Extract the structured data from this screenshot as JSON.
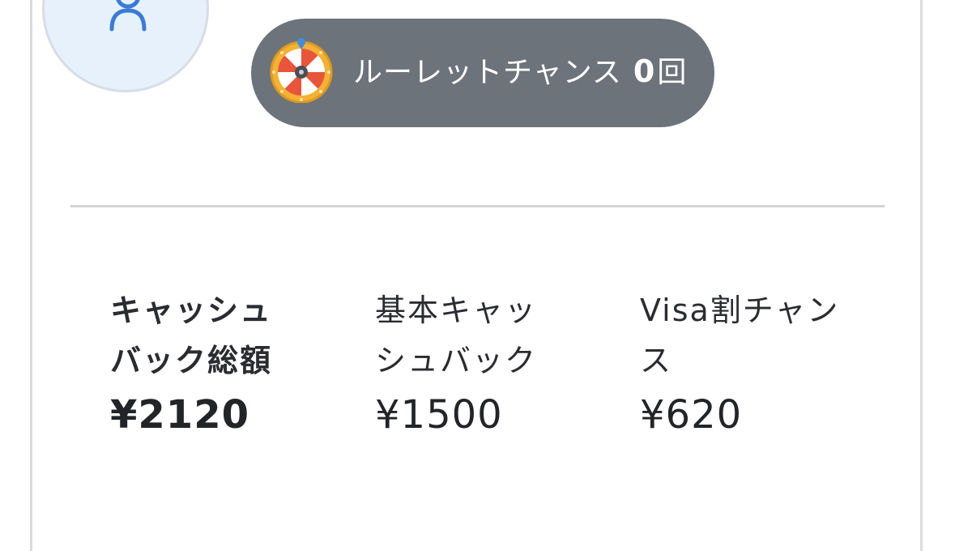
{
  "avatar": {
    "icon": "user-icon",
    "bg_color": "#e7f1fc",
    "icon_color": "#3a7bd5"
  },
  "roulette": {
    "icon": "roulette-wheel-icon",
    "label": "ルーレットチャンス",
    "count": "0",
    "unit": "回",
    "pill_color": "#6d737b"
  },
  "cashback": {
    "total": {
      "label": "キャッシュバック総額",
      "value": "¥2120"
    },
    "basic": {
      "label": "基本キャッシュバック",
      "value": "¥1500"
    },
    "visa": {
      "label": "Visa割チャンス",
      "value": "¥620"
    }
  }
}
